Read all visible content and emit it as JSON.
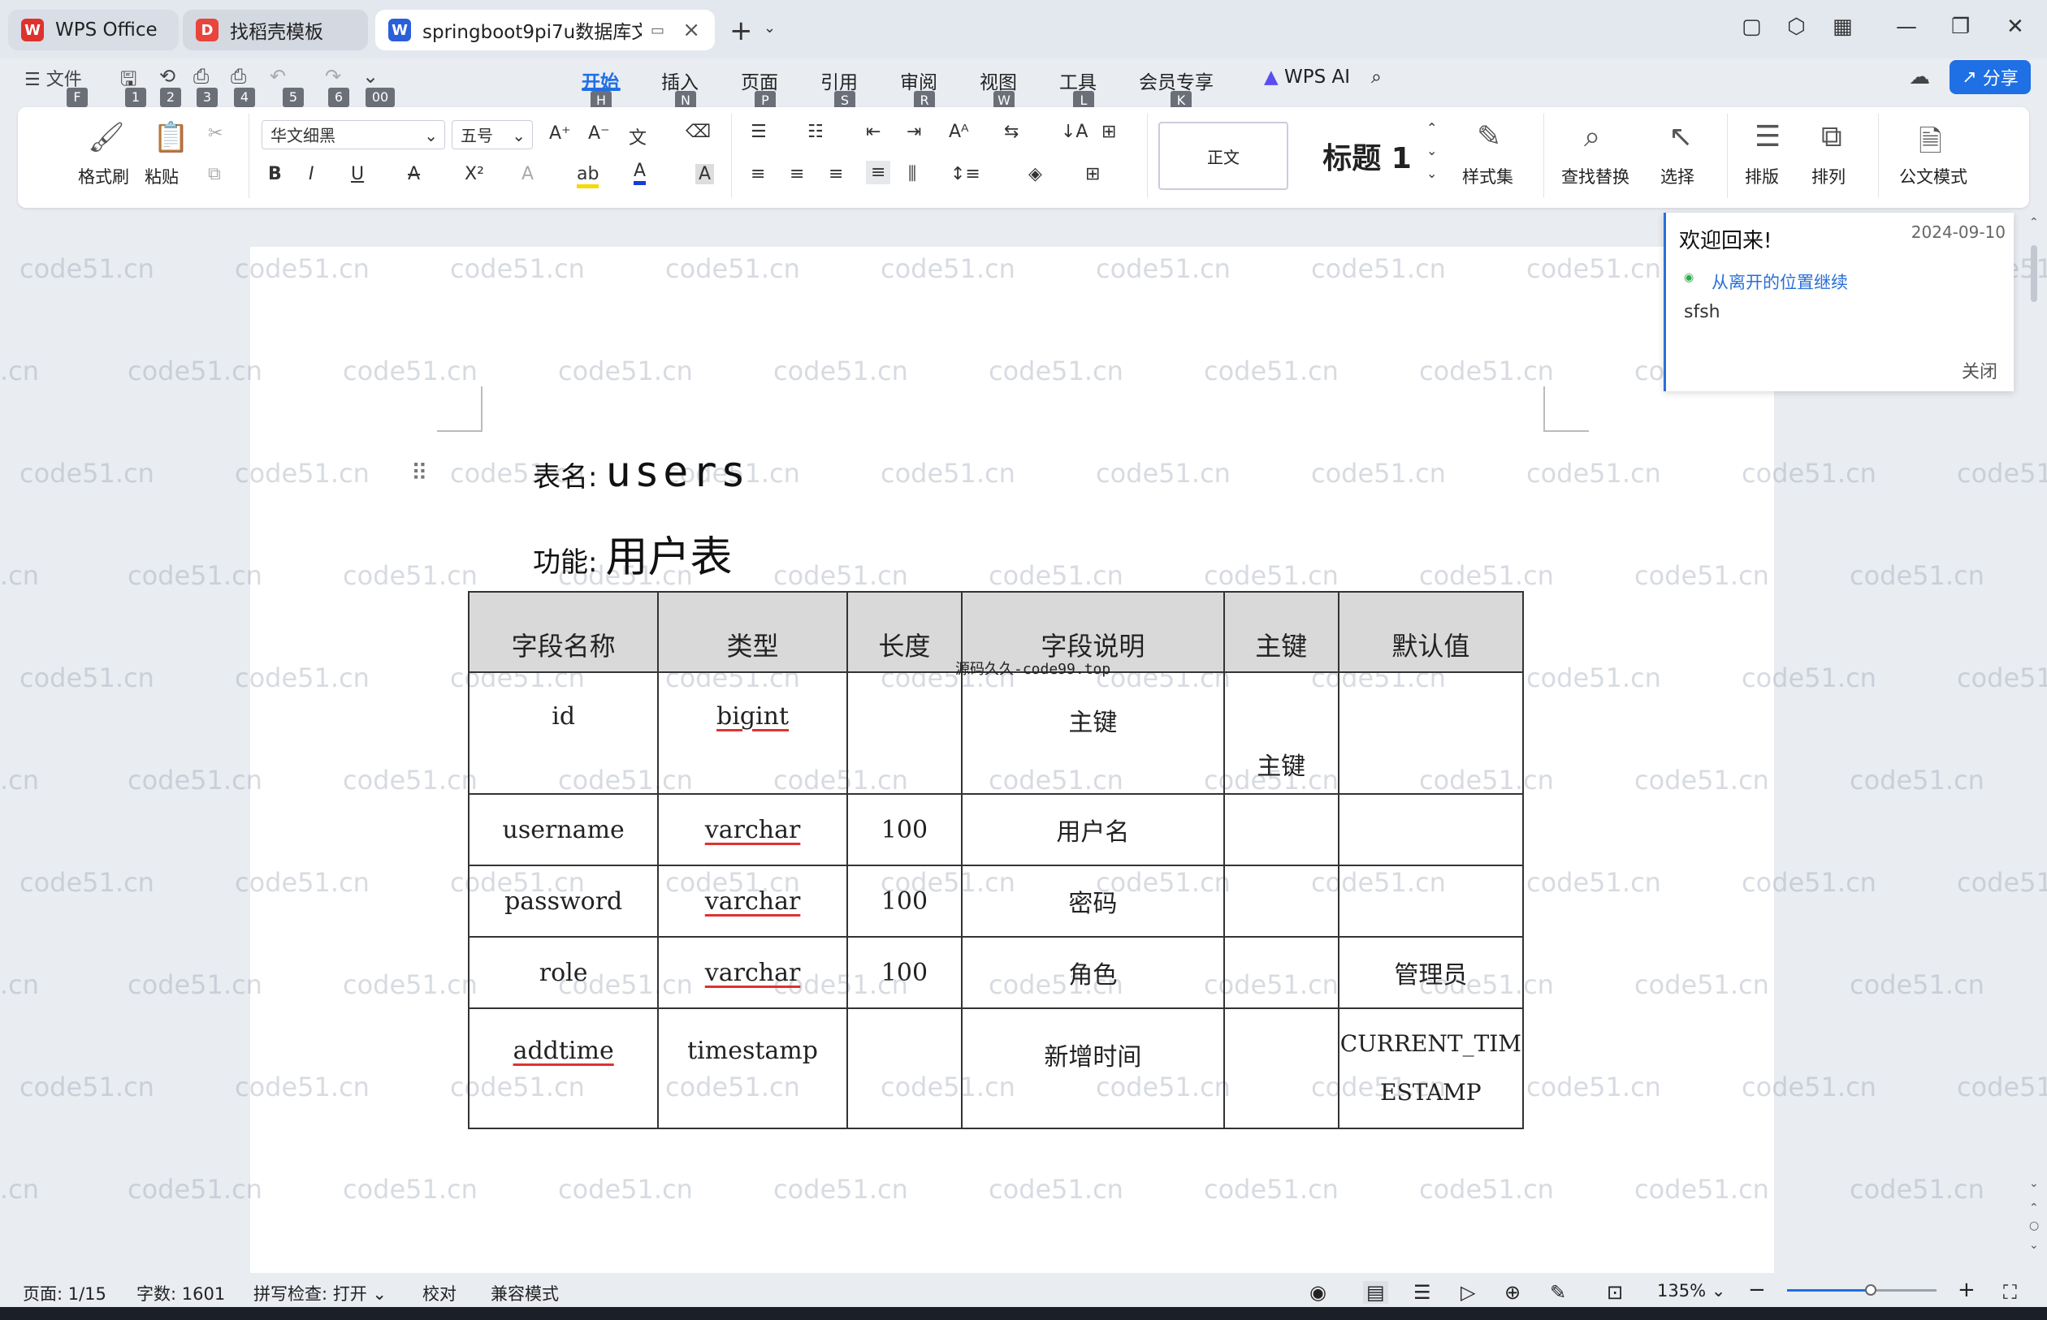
{
  "tabs": [
    {
      "label": "WPS Office"
    },
    {
      "label": "找稻壳模板"
    },
    {
      "label": "springboot9pi7u数据库文档"
    }
  ],
  "menu": {
    "file": "文件",
    "items": [
      "开始",
      "插入",
      "页面",
      "引用",
      "审阅",
      "视图",
      "工具",
      "会员专享"
    ],
    "ai": "WPS AI",
    "share": "分享",
    "keytips": {
      "file": "F",
      "q1": "1",
      "q2": "2",
      "q3": "3",
      "q4": "4",
      "q5": "5",
      "q6": "6",
      "q7": "00",
      "home": "H",
      "insert": "N",
      "page": "P",
      "ref": "S",
      "review": "R",
      "view": "W",
      "tools": "L",
      "member": "K"
    }
  },
  "ribbon": {
    "format_painter": "格式刷",
    "paste": "粘贴",
    "font_name": "华文细黑",
    "font_size": "五号",
    "style_normal": "正文",
    "style_heading": "标题 1",
    "style_set": "样式集",
    "find_replace": "查找替换",
    "select": "选择",
    "layout": "排版",
    "arrange": "排列",
    "official_mode": "公文模式"
  },
  "document": {
    "table_name_label": "表名:",
    "table_name": "users",
    "function_label": "功能:",
    "function_value": "用户表",
    "source_note": "源码久久-code99.top",
    "headers": [
      "字段名称",
      "类型",
      "长度",
      "字段说明",
      "主键",
      "默认值"
    ],
    "rows": [
      {
        "name": "id",
        "type": "bigint",
        "len": "",
        "desc": "主键",
        "pk": "主键",
        "def": ""
      },
      {
        "name": "username",
        "type": "varchar",
        "len": "100",
        "desc": "用户名",
        "pk": "",
        "def": ""
      },
      {
        "name": "password",
        "type": "varchar",
        "len": "100",
        "desc": "密码",
        "pk": "",
        "def": ""
      },
      {
        "name": "role",
        "type": "varchar",
        "len": "100",
        "desc": "角色",
        "pk": "",
        "def": "管理员"
      },
      {
        "name": "addtime",
        "type": "timestamp",
        "len": "",
        "desc": "新增时间",
        "pk": "",
        "def_line1": "CURRENT_TIM",
        "def_line2": "ESTAMP"
      }
    ]
  },
  "notification": {
    "title": "欢迎回来!",
    "date": "2024-09-10",
    "resume_link": "从离开的位置继续",
    "snippet": "sfsh",
    "close": "关闭"
  },
  "status": {
    "page": "页面: 1/15",
    "words": "字数: 1601",
    "spell": "拼写检查: 打开",
    "proof": "校对",
    "compat": "兼容模式",
    "zoom": "135%"
  },
  "watermark": "code51.cn",
  "watermark_partial": ".cn",
  "colors": {
    "accent": "#1f6fe5",
    "wps_red": "#e0322d",
    "header_fill": "#d9d9d9"
  }
}
